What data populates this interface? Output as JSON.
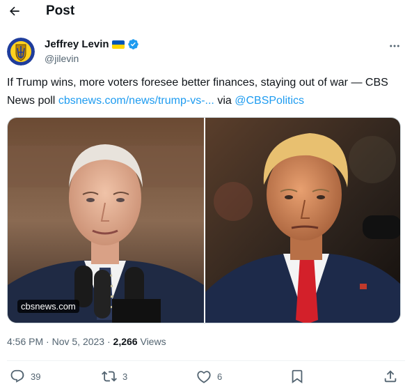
{
  "header": {
    "title": "Post",
    "back_icon": "arrow-left-icon"
  },
  "author": {
    "name": "Jeffrey Levin",
    "handle": "@jilevin",
    "flag_icon": "ukraine-flag-icon",
    "verified_icon": "verified-badge-icon",
    "verified_color": "#1d9bf0"
  },
  "tweet": {
    "text_plain": "If Trump wins, more voters foresee better finances, staying out of war — CBS News poll ",
    "link": "cbsnews.com/news/trump-vs-...",
    "via": " via ",
    "mention": "@CBSPolitics",
    "link_color": "#1d9bf0"
  },
  "media": {
    "watermark": "cbsnews.com"
  },
  "meta": {
    "time": "4:56 PM",
    "sep": " · ",
    "date": "Nov 5, 2023",
    "views": "2,266",
    "views_label": " Views"
  },
  "actions": {
    "replies": "39",
    "reposts": "3",
    "likes": "6"
  }
}
